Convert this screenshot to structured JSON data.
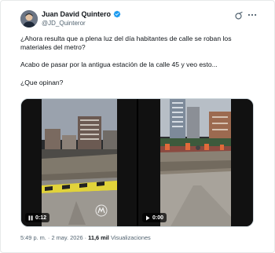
{
  "author": {
    "display_name": "Juan David Quintero",
    "handle": "@JD_Quinteror"
  },
  "tweet": {
    "line1": "¿Ahora resulta que a plena luz del día habitantes de calle se roban los materiales del metro?",
    "line2": "Acabo de pasar por la antigua estación de la calle 45 y veo esto...",
    "line3": "¿Que opinan?"
  },
  "media": {
    "videos": [
      {
        "duration": "0:12",
        "state": "paused"
      },
      {
        "duration": "0:00",
        "state": "play"
      }
    ]
  },
  "meta": {
    "time": "5:49 p. m.",
    "separator": " · ",
    "date": "2 may. 2026",
    "views_count": "11,6 mil",
    "views_label": "Visualizaciones"
  },
  "icons": {
    "verified": "verified-badge-icon",
    "grok": "grok-icon",
    "more": "more-options-icon",
    "pause": "pause-icon",
    "play": "play-icon",
    "watermark": "metro-watermark-icon"
  },
  "colors": {
    "verified": "#1d9bf0",
    "text_primary": "#0f1419",
    "text_secondary": "#536471",
    "border": "#e7e9ea"
  }
}
